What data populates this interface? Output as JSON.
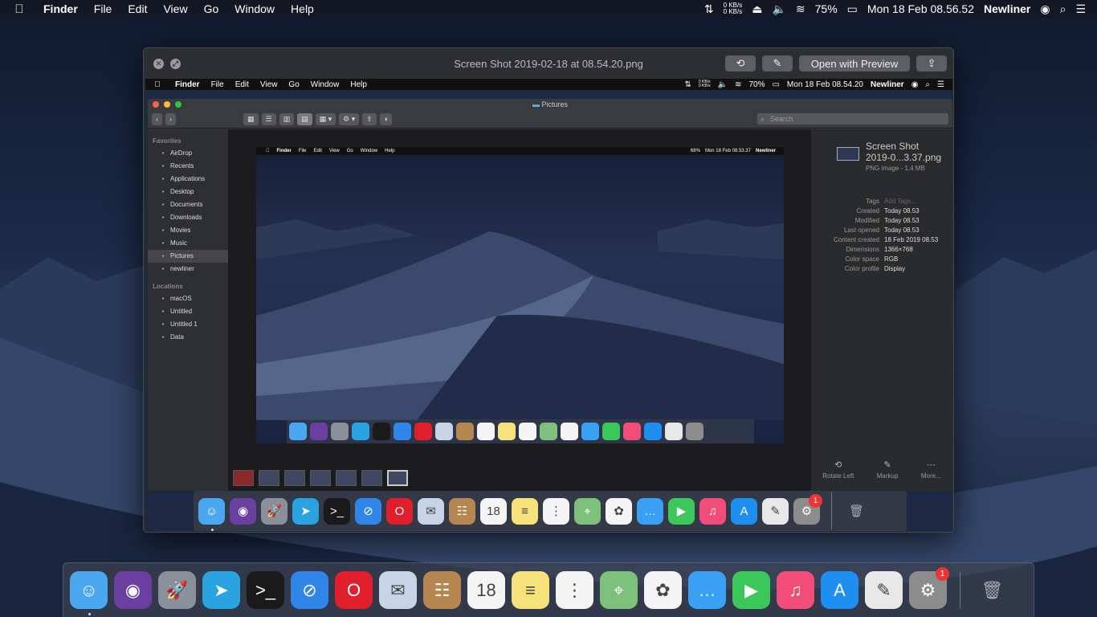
{
  "menubar": {
    "app": "Finder",
    "menus": [
      "File",
      "Edit",
      "View",
      "Go",
      "Window",
      "Help"
    ],
    "net_up": "0 KB/s",
    "net_down": "0 KB/s",
    "battery": "75%",
    "clock": "Mon 18 Feb  08.56.52",
    "user": "Newliner"
  },
  "window": {
    "title": "Screen Shot 2019-02-18 at 08.54.20.png",
    "open_with_label": "Open with Preview"
  },
  "inner_menubar": {
    "app": "Finder",
    "menus": [
      "File",
      "Edit",
      "View",
      "Go",
      "Window",
      "Help"
    ],
    "net_up": "0 KB/s",
    "net_down": "0 KB/s",
    "battery": "70%",
    "clock": "Mon 18 Feb  08.54.20",
    "user": "Newliner"
  },
  "finder": {
    "title": "Pictures",
    "search_placeholder": "Search",
    "favorites_header": "Favorites",
    "favorites": [
      {
        "label": "AirDrop",
        "icon": "airdrop-icon"
      },
      {
        "label": "Recents",
        "icon": "recents-icon"
      },
      {
        "label": "Applications",
        "icon": "applications-icon"
      },
      {
        "label": "Desktop",
        "icon": "desktop-icon"
      },
      {
        "label": "Documents",
        "icon": "documents-icon"
      },
      {
        "label": "Downloads",
        "icon": "downloads-icon"
      },
      {
        "label": "Movies",
        "icon": "movies-icon"
      },
      {
        "label": "Music",
        "icon": "music-icon"
      },
      {
        "label": "Pictures",
        "icon": "pictures-icon",
        "selected": true
      },
      {
        "label": "newliner",
        "icon": "home-icon"
      }
    ],
    "locations_header": "Locations",
    "locations": [
      {
        "label": "macOS",
        "icon": "disk-icon"
      },
      {
        "label": "Untitled",
        "icon": "disk-icon"
      },
      {
        "label": "Untitled 1",
        "icon": "disk-icon"
      },
      {
        "label": "Data",
        "icon": "disk-icon"
      }
    ],
    "preview_menubar": {
      "app": "Finder",
      "menus": [
        "File",
        "Edit",
        "View",
        "Go",
        "Window",
        "Help"
      ],
      "battery": "68%",
      "clock": "Mon 18 Feb  08.53.37",
      "user": "Newliner"
    },
    "info": {
      "name": "Screen Shot 2019-0...3.37.png",
      "kind": "PNG image - 1,4 MB",
      "rows": [
        {
          "k": "Tags",
          "v": "Add Tags...",
          "dim": true
        },
        {
          "k": "Created",
          "v": "Today 08.53"
        },
        {
          "k": "Modified",
          "v": "Today 08.53"
        },
        {
          "k": "Last opened",
          "v": "Today 08.53"
        },
        {
          "k": "Content created",
          "v": "18 Feb 2019 08.53"
        },
        {
          "k": "Dimensions",
          "v": "1366×768"
        },
        {
          "k": "Color space",
          "v": "RGB"
        },
        {
          "k": "Color profile",
          "v": "Display"
        }
      ],
      "actions": [
        "Rotate Left",
        "Markup",
        "More..."
      ]
    }
  },
  "dock": {
    "apps": [
      {
        "name": "Finder",
        "icon": "finder-icon",
        "color": "#4aa7f0",
        "glyph": "☺",
        "running": true
      },
      {
        "name": "Siri",
        "icon": "siri-icon",
        "color": "#6b3fa0",
        "glyph": "◉"
      },
      {
        "name": "Launchpad",
        "icon": "launchpad-icon",
        "color": "#8a8f99",
        "glyph": "🚀"
      },
      {
        "name": "Telegram",
        "icon": "telegram-icon",
        "color": "#2aa3e0",
        "glyph": "➤"
      },
      {
        "name": "Terminal",
        "icon": "terminal-icon",
        "color": "#1a1a1a",
        "glyph": ">_"
      },
      {
        "name": "Safari",
        "icon": "safari-icon",
        "color": "#2f86e8",
        "glyph": "⊘"
      },
      {
        "name": "Opera",
        "icon": "opera-icon",
        "color": "#e01e2c",
        "glyph": "O"
      },
      {
        "name": "Mail",
        "icon": "mail-icon",
        "color": "#c7d4e8",
        "glyph": "✉"
      },
      {
        "name": "Contacts",
        "icon": "contacts-icon",
        "color": "#b58650",
        "glyph": "☷"
      },
      {
        "name": "Calendar",
        "icon": "calendar-icon",
        "color": "#f4f4f4",
        "glyph": "18"
      },
      {
        "name": "Notes",
        "icon": "notes-icon",
        "color": "#f6e27a",
        "glyph": "≡"
      },
      {
        "name": "Reminders",
        "icon": "reminders-icon",
        "color": "#f4f4f4",
        "glyph": "⋮"
      },
      {
        "name": "Maps",
        "icon": "maps-icon",
        "color": "#7cc07c",
        "glyph": "⌖"
      },
      {
        "name": "Photos",
        "icon": "photos-icon",
        "color": "#f4f4f4",
        "glyph": "✿"
      },
      {
        "name": "Messages",
        "icon": "messages-icon",
        "color": "#3aa0f5",
        "glyph": "…"
      },
      {
        "name": "FaceTime",
        "icon": "facetime-icon",
        "color": "#3cc75a",
        "glyph": "▶"
      },
      {
        "name": "iTunes",
        "icon": "itunes-icon",
        "color": "#f24d7a",
        "glyph": "♫"
      },
      {
        "name": "App Store",
        "icon": "appstore-icon",
        "color": "#1e8ef0",
        "glyph": "A"
      },
      {
        "name": "TextEdit",
        "icon": "textedit-icon",
        "color": "#e8e8e8",
        "glyph": "✎"
      },
      {
        "name": "System Preferences",
        "icon": "settings-icon",
        "color": "#8c8c8c",
        "glyph": "⚙",
        "badge": "1"
      }
    ],
    "trash": {
      "name": "Trash",
      "icon": "trash-icon"
    }
  },
  "colors": {
    "menubar_bg": "#141822",
    "window_bg": "#2a2b2e",
    "accent": "#3b82f6",
    "badge": "#ee3333"
  }
}
